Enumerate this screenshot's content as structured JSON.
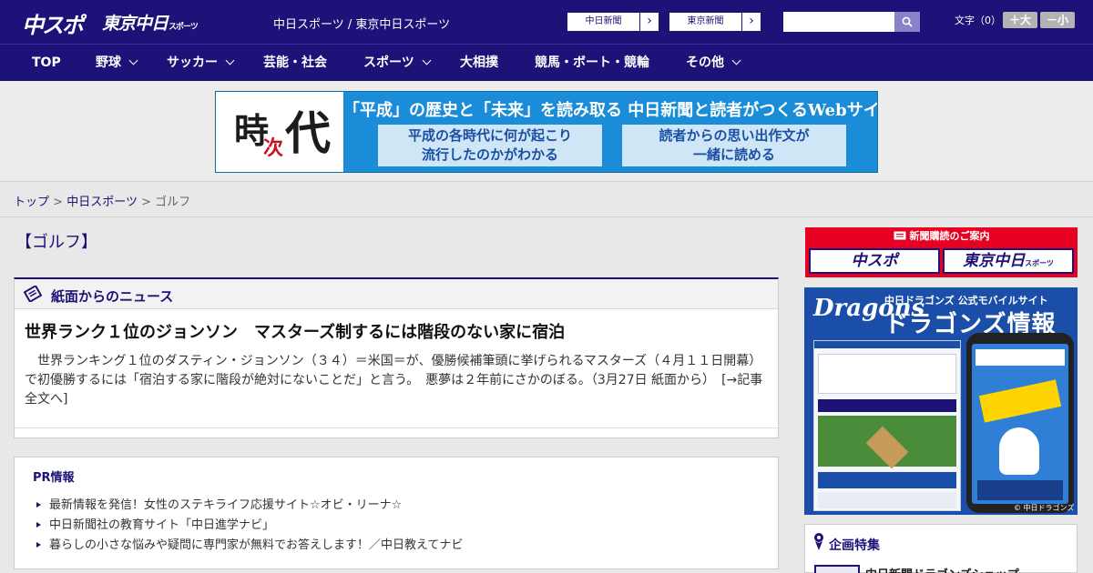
{
  "header": {
    "logo_main": "中スポ",
    "logo_tokyo": "東京中日",
    "logo_tokyo_small": "スポーツ",
    "site_links": "中日スポーツ / 東京中日スポーツ",
    "newspaper_buttons": [
      "中日新聞",
      "東京新聞"
    ],
    "search_placeholder": "",
    "text_size_label": "文字（0）",
    "text_size_buttons": [
      "＋大",
      "－小"
    ]
  },
  "nav": {
    "items": [
      {
        "label": "TOP",
        "dropdown": false
      },
      {
        "label": "野球",
        "dropdown": true
      },
      {
        "label": "サッカー",
        "dropdown": true
      },
      {
        "label": "芸能・社会",
        "dropdown": false
      },
      {
        "label": "スポーツ",
        "dropdown": true
      },
      {
        "label": "大相撲",
        "dropdown": false
      },
      {
        "label": "競馬・ボート・競輪",
        "dropdown": false
      },
      {
        "label": "その他",
        "dropdown": true
      }
    ]
  },
  "banner": {
    "kanji_ji": "時",
    "kanji_tsugi": "次",
    "kanji_dai": "代",
    "headline": "「平成」の歴史と「未来」を読み取る 中日新聞と読者がつくるWebサイト",
    "box_left": [
      "平成の各時代に何が起こり",
      "流行したのかがわかる"
    ],
    "box_right": [
      "読者からの思い出作文が",
      "一緒に読める"
    ]
  },
  "breadcrumb": {
    "items": [
      "トップ",
      "中日スポーツ"
    ],
    "sep": ">",
    "current": "ゴルフ"
  },
  "page_title": "【ゴルフ】",
  "news": {
    "section_title": "紙面からのニュース",
    "article_title": "世界ランク１位のジョンソン　マスターズ制するには階段のない家に宿泊",
    "article_body": "　世界ランキング１位のダスティン・ジョンソン（３４）＝米国＝が、優勝候補筆頭に挙げられるマスターズ（４月１１日開幕）で初優勝するには「宿泊する家に階段が絶対にないことだ」と言う。　悪夢は２年前にさかのぼる。（3月27日 紙面から）",
    "more_link": "[→記事全文へ]"
  },
  "pr": {
    "title": "PR情報",
    "items": [
      "最新情報を発信！女性のステキライフ応援サイト☆オビ・リーナ☆",
      "中日新聞社の教育サイト「中日進学ナビ」",
      "暮らしの小さな悩みや疑問に専門家が無料でお答えします！／中日教えてナビ"
    ]
  },
  "sidebar": {
    "subscribe": {
      "head": "新聞購読のご案内",
      "btn_chuspo": "中スポ",
      "btn_tokyo": "東京中日",
      "btn_tokyo_small": "スポーツ"
    },
    "dragons_ad": {
      "logo": "Dragons",
      "sub": "中日ドラゴンズ 公式モバイルサイト",
      "big": "ドラゴンズ情報",
      "copyright": "© 中日ドラゴンズ"
    },
    "kikaku": {
      "title": "企画特集",
      "item": "中日新聞ドラゴンズショップ"
    }
  }
}
